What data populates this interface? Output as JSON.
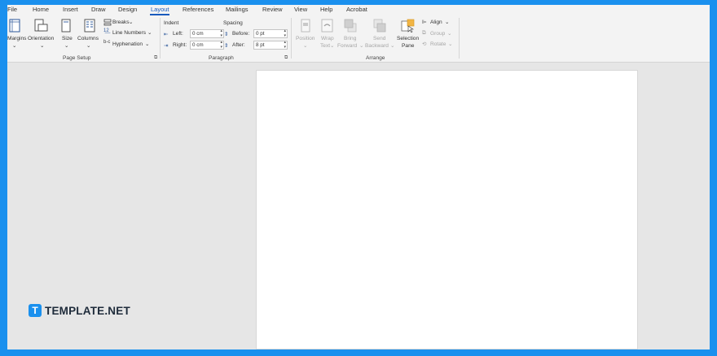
{
  "tabs": [
    "File",
    "Home",
    "Insert",
    "Draw",
    "Design",
    "Layout",
    "References",
    "Mailings",
    "Review",
    "View",
    "Help",
    "Acrobat"
  ],
  "page_setup": {
    "margins": "Margins",
    "orientation": "Orientation",
    "size": "Size",
    "columns": "Columns",
    "breaks": "Breaks",
    "line_numbers": "Line Numbers",
    "hyphenation": "Hyphenation",
    "group": "Page Setup"
  },
  "paragraph": {
    "indent": "Indent",
    "spacing": "Spacing",
    "left_label": "Left:",
    "left_value": "0 cm",
    "right_label": "Right:",
    "right_value": "0 cm",
    "before_label": "Before:",
    "before_value": "0 pt",
    "after_label": "After:",
    "after_value": "8 pt",
    "group": "Paragraph"
  },
  "arrange": {
    "position": "Position",
    "wrap_1": "Wrap",
    "wrap_2": "Text",
    "bring_1": "Bring",
    "bring_2": "Forward",
    "send_1": "Send",
    "send_2": "Backward",
    "selection_1": "Selection",
    "selection_2": "Pane",
    "align": "Align",
    "group_btn": "Group",
    "rotate": "Rotate",
    "group": "Arrange"
  },
  "logo": {
    "mark": "T",
    "text": "TEMPLATE.NET"
  },
  "colors": {
    "accent": "#185abd",
    "brand": "#1a90ee"
  }
}
